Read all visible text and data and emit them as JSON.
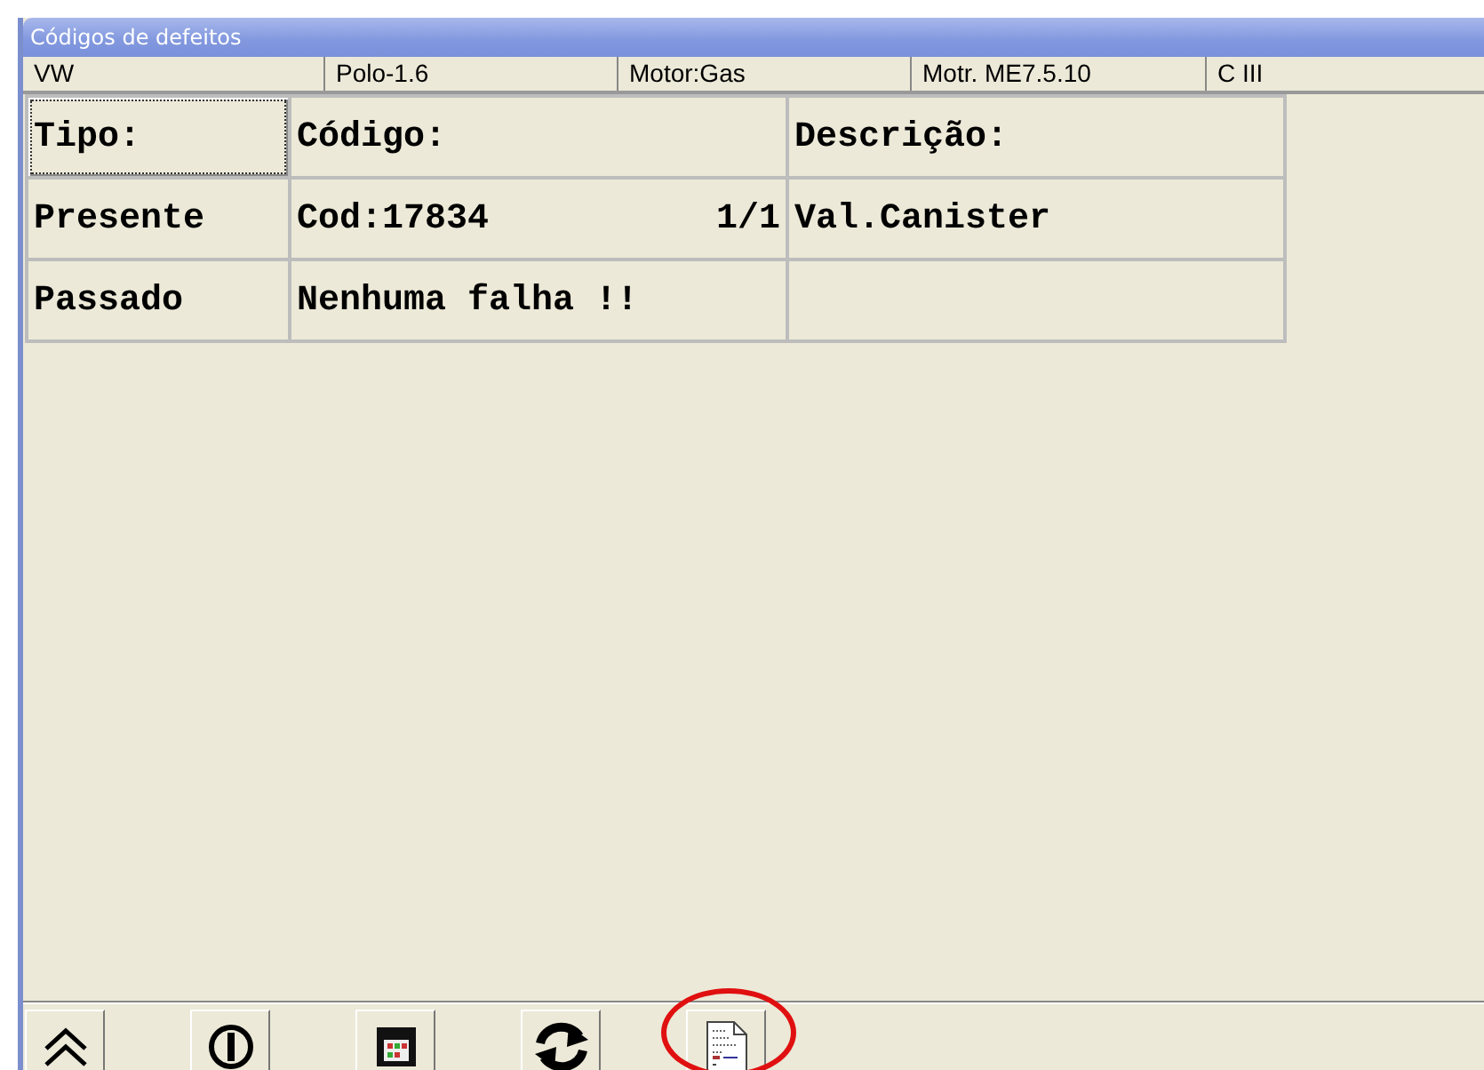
{
  "window": {
    "title": "Códigos de defeitos"
  },
  "info_bar": [
    "VW",
    "Polo-1.6",
    "Motor:Gas",
    "Motr. ME7.5.10",
    "C III"
  ],
  "table": {
    "rows": [
      {
        "cells": [
          {
            "text": "Tipo:",
            "focused": true
          },
          {
            "text": "Código:",
            "focused": false
          },
          {
            "text": "Descrição:",
            "focused": false
          }
        ]
      },
      {
        "cells": [
          {
            "text": "Presente",
            "focused": false
          },
          {
            "text": "Cod:17834",
            "suffix": "1/1",
            "focused": false
          },
          {
            "text": "Val.Canister",
            "focused": false
          }
        ]
      },
      {
        "cells": [
          {
            "text": "Passado",
            "focused": false
          },
          {
            "text": "Nenhuma falha !!",
            "focused": false
          },
          {
            "focused": false
          }
        ]
      }
    ]
  },
  "toolbar": [
    {
      "kind": "up",
      "highlighted": false
    },
    {
      "kind": "power",
      "highlighted": false
    },
    {
      "kind": "panel",
      "highlighted": false
    },
    {
      "kind": "refresh",
      "highlighted": false
    },
    {
      "kind": "document",
      "highlighted": true
    }
  ]
}
